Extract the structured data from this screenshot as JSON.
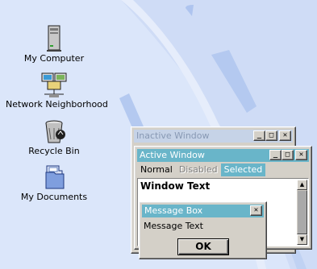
{
  "desktop": {
    "icons": [
      {
        "label": "My Computer",
        "icon": "computer-icon"
      },
      {
        "label": "Network Neighborhood",
        "icon": "network-icon"
      },
      {
        "label": "Recycle Bin",
        "icon": "recycle-bin-icon"
      },
      {
        "label": "My Documents",
        "icon": "documents-folder-icon"
      }
    ]
  },
  "inactive_window": {
    "title": "Inactive Window"
  },
  "active_window": {
    "title": "Active Window",
    "menu": [
      {
        "label": "Normal",
        "state": "normal"
      },
      {
        "label": "Disabled",
        "state": "disabled"
      },
      {
        "label": "Selected",
        "state": "selected"
      }
    ],
    "window_text": "Window Text"
  },
  "message_box": {
    "title": "Message Box",
    "text": "Message Text",
    "ok_label": "OK"
  },
  "title_buttons": {
    "minimize": "_",
    "maximize": "□",
    "close": "✕"
  },
  "colors": {
    "desktop": "#dbe6fa",
    "active_title": "#69b5c9",
    "inactive_title": "#c6d3e7",
    "inactive_title_text": "#8899b4"
  }
}
